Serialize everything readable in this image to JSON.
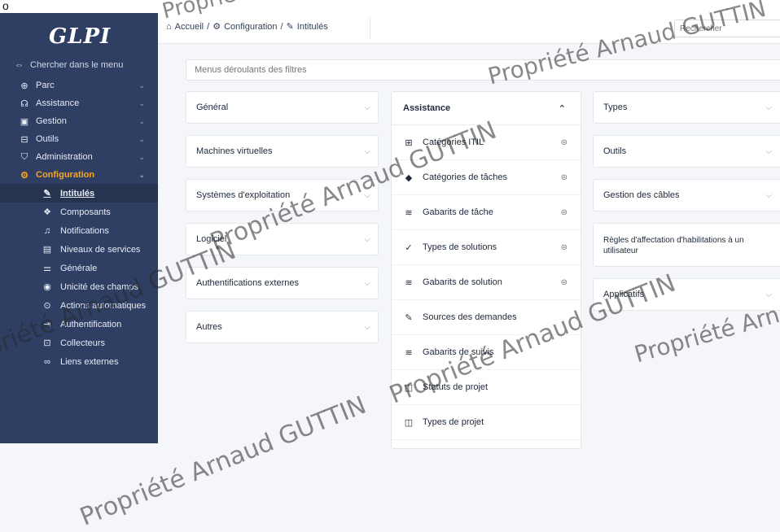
{
  "caption": "o ",
  "logo": "GLPI",
  "sidebar": {
    "search_label": "Chercher dans le menu",
    "items": [
      {
        "label": "Parc",
        "icon": "package-icon",
        "glyph": "⊕"
      },
      {
        "label": "Assistance",
        "icon": "headset-icon",
        "glyph": "☊"
      },
      {
        "label": "Gestion",
        "icon": "wallet-icon",
        "glyph": "▣"
      },
      {
        "label": "Outils",
        "icon": "briefcase-icon",
        "glyph": "⊟"
      },
      {
        "label": "Administration",
        "icon": "shield-icon",
        "glyph": "⛉"
      },
      {
        "label": "Configuration",
        "icon": "gear-icon",
        "glyph": "⚙"
      }
    ],
    "subitems": [
      {
        "label": "Intitulés",
        "icon": "edit-icon",
        "glyph": "✎"
      },
      {
        "label": "Composants",
        "icon": "components-icon",
        "glyph": "❖"
      },
      {
        "label": "Notifications",
        "icon": "bell-icon",
        "glyph": "♫"
      },
      {
        "label": "Niveaux de services",
        "icon": "clipboard-icon",
        "glyph": "▤"
      },
      {
        "label": "Générale",
        "icon": "sliders-icon",
        "glyph": "⚌"
      },
      {
        "label": "Unicité des champs",
        "icon": "fingerprint-icon",
        "glyph": "◉"
      },
      {
        "label": "Actions automatiques",
        "icon": "clock-icon",
        "glyph": "⊙"
      },
      {
        "label": "Authentification",
        "icon": "login-icon",
        "glyph": "⇥"
      },
      {
        "label": "Collecteurs",
        "icon": "inbox-icon",
        "glyph": "⊡"
      },
      {
        "label": "Liens externes",
        "icon": "link-icon",
        "glyph": "∞"
      }
    ]
  },
  "breadcrumb": {
    "home": "Accueil",
    "section": "Configuration",
    "current": "Intitulés"
  },
  "search_placeholder": "Rechercher",
  "filter_placeholder": "Menus déroulants des filtres",
  "col1": [
    "Général",
    "Machines virtuelles",
    "Systèmes d'exploitation",
    "Logiciel",
    "Authentifications externes",
    "Autres"
  ],
  "assistance": {
    "title": "Assistance",
    "items": [
      {
        "label": "Catégories ITIL",
        "icon": "sitemap-icon",
        "glyph": "⊞",
        "stack": true
      },
      {
        "label": "Catégories de tâches",
        "icon": "tag-icon",
        "glyph": "◆",
        "stack": true
      },
      {
        "label": "Gabarits de tâche",
        "icon": "stack-icon",
        "glyph": "≋",
        "stack": true
      },
      {
        "label": "Types de solutions",
        "icon": "check-icon",
        "glyph": "✓",
        "stack": true
      },
      {
        "label": "Gabarits de solution",
        "icon": "stack-icon",
        "glyph": "≋",
        "stack": true
      },
      {
        "label": "Sources des demandes",
        "icon": "edit-icon",
        "glyph": "✎",
        "stack": false
      },
      {
        "label": "Gabarits de suivis",
        "icon": "stack-icon",
        "glyph": "≋",
        "stack": false
      },
      {
        "label": "Statuts de projet",
        "icon": "layout-icon",
        "glyph": "◫",
        "stack": false
      },
      {
        "label": "Types de projet",
        "icon": "layout-icon",
        "glyph": "◫",
        "stack": false
      }
    ]
  },
  "col3": [
    "Types",
    "Outils",
    "Gestion des câbles",
    "Règles d'affectation d'habilitations à un utilisateur",
    "Applicatifs"
  ],
  "watermarks": [
    "Propriété Arnaud GUTTIN",
    "Propriété Arnaud GUTTIN",
    "Propriété Arnaud GUTTIN",
    "Propriété Arnaud GUTTIN",
    "Propriété Arnaud GUTTIN",
    "Propriété Arnaud GUTTIN",
    "Propriété Arnaud GUTTIN"
  ]
}
